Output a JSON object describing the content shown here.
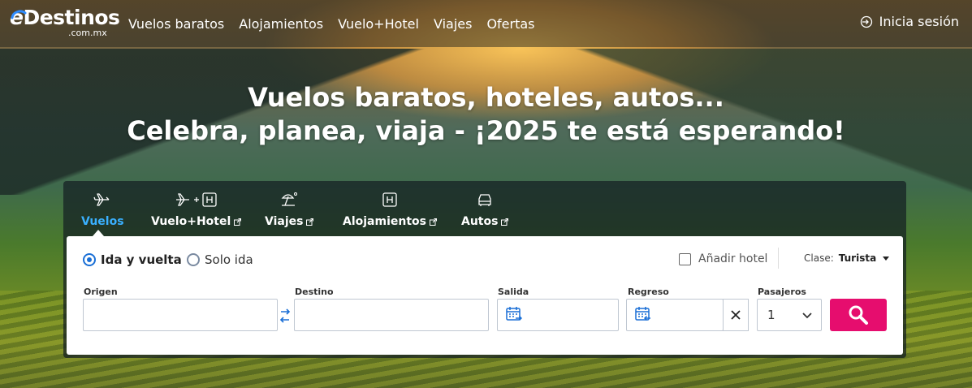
{
  "brand": {
    "name_e": "e",
    "name_rest": "Destinos",
    "domain": ".com.mx"
  },
  "nav": {
    "items": [
      "Vuelos baratos",
      "Alojamientos",
      "Vuelo+Hotel",
      "Viajes",
      "Ofertas"
    ],
    "login": "Inicia sesión"
  },
  "hero": {
    "line1": "Vuelos baratos, hoteles, autos...",
    "line2": "Celebra, planea, viaja - ¡2025 te está esperando!"
  },
  "tabs": [
    {
      "label": "Vuelos",
      "icon": "plane-icon",
      "active": true
    },
    {
      "label": "Vuelo+Hotel",
      "icon": "plane-hotel-icon",
      "external": true
    },
    {
      "label": "Viajes",
      "icon": "beach-icon",
      "external": true
    },
    {
      "label": "Alojamientos",
      "icon": "hotel-icon",
      "external": true
    },
    {
      "label": "Autos",
      "icon": "car-icon",
      "external": true
    }
  ],
  "trip": {
    "roundtrip": "Ida y vuelta",
    "oneway": "Solo ida",
    "selected": "roundtrip"
  },
  "add_hotel": "Añadir hotel",
  "clase": {
    "label": "Clase:",
    "value": "Turista"
  },
  "fields": {
    "origen": {
      "label": "Origen",
      "value": ""
    },
    "destino": {
      "label": "Destino",
      "value": ""
    },
    "salida": {
      "label": "Salida",
      "value": ""
    },
    "regreso": {
      "label": "Regreso",
      "value": ""
    },
    "pasajeros": {
      "label": "Pasajeros",
      "value": "1"
    }
  },
  "colors": {
    "accent": "#1a6fd6",
    "active_tab": "#3ab0ff",
    "search_button": "#e60d6e"
  }
}
